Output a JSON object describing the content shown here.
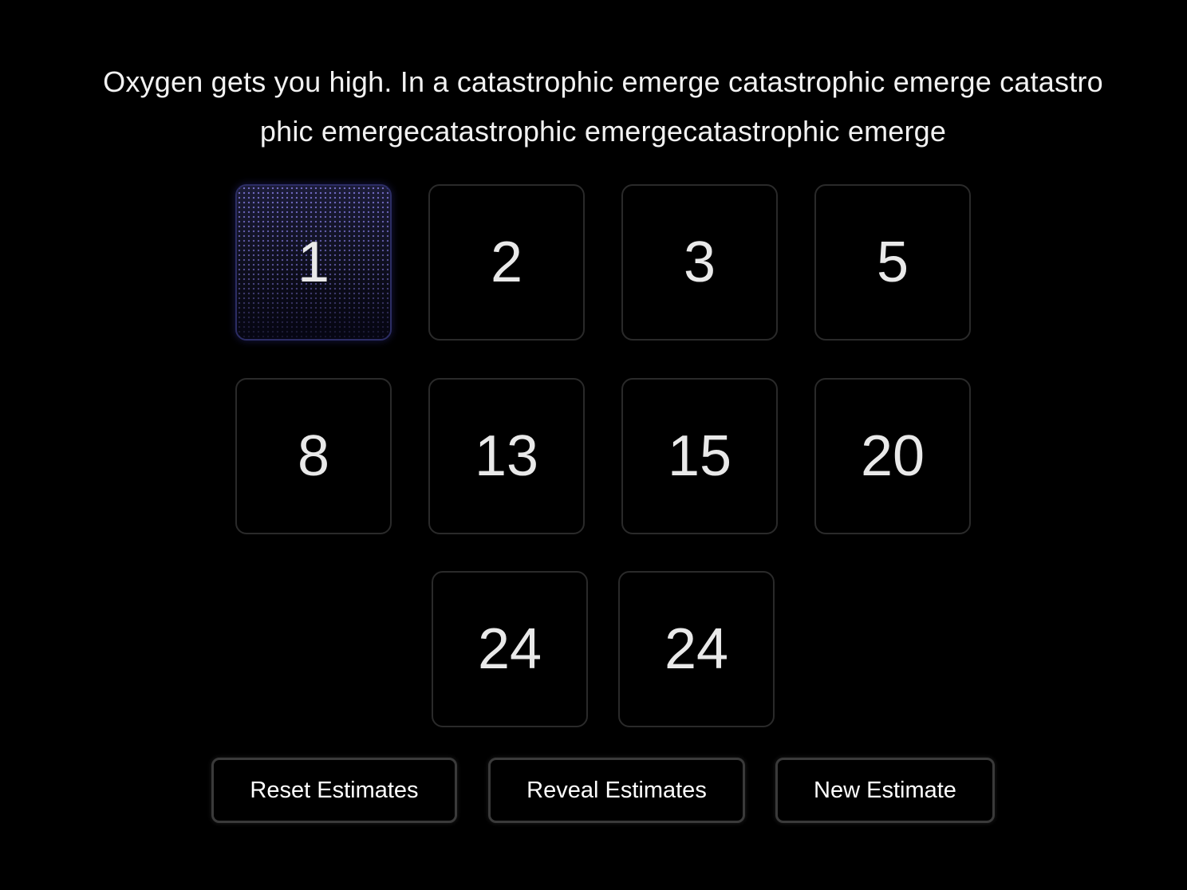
{
  "question": {
    "line1": "Oxygen gets you high. In a catastrophic emerge catastrophic emerge catastro",
    "line2": "phic emergecatastrophic emergecatastrophic emerge"
  },
  "cards": {
    "selected_value": "1",
    "row1": [
      "1",
      "2",
      "3",
      "5"
    ],
    "row2": [
      "8",
      "13",
      "15",
      "20"
    ],
    "row3": [
      "24",
      "24"
    ]
  },
  "actions": {
    "reset": "Reset Estimates",
    "reveal": "Reveal Estimates",
    "new": "New Estimate"
  },
  "colors": {
    "background": "#000000",
    "card_border": "#2a2a2a",
    "selected_accent": "#2c2d64",
    "text": "#ececec"
  }
}
